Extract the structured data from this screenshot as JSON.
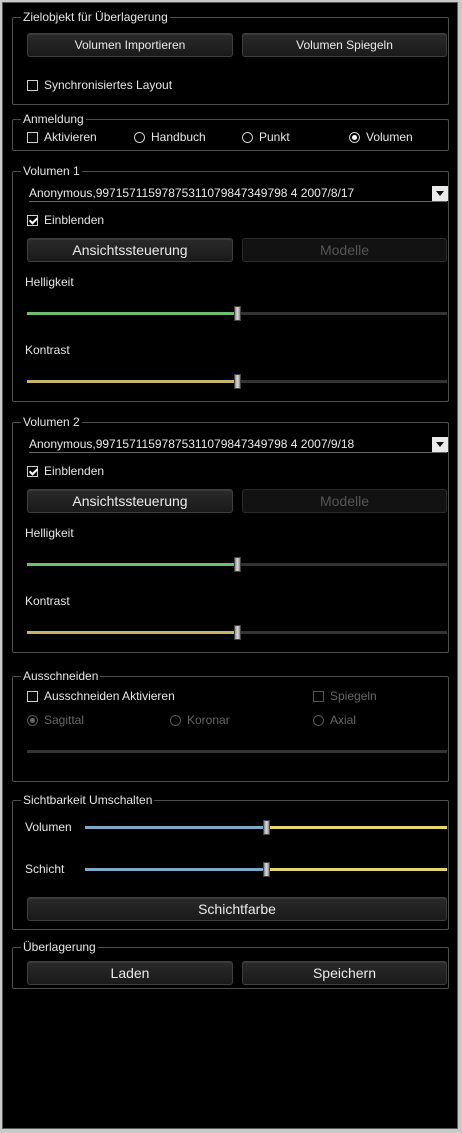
{
  "colors": {
    "brightness_track": "#6fbf6f",
    "contrast_track": "#c8b36a",
    "visibility_left": "#7ea9c9",
    "visibility_right": "#e6d868"
  },
  "target": {
    "title": "Zielobjekt für Überlagerung",
    "import_label": "Volumen Importieren",
    "mirror_label": "Volumen Spiegeln",
    "sync_label": "Synchronisiertes Layout",
    "sync_checked": false
  },
  "registration": {
    "title": "Anmeldung",
    "activate_label": "Aktivieren",
    "activate_checked": false,
    "options": [
      "Handbuch",
      "Punkt",
      "Volumen"
    ],
    "selected": "Volumen"
  },
  "volume1": {
    "title": "Volumen 1",
    "selected_volume": "Anonymous,99715711597875311079847349798 4  2007/8/17",
    "show_label": "Einblenden",
    "show_checked": true,
    "view_control_label": "Ansichtssteuerung",
    "models_label": "Modelle",
    "brightness_label": "Helligkeit",
    "brightness_value": 0.5,
    "contrast_label": "Kontrast",
    "contrast_value": 0.5
  },
  "volume2": {
    "title": "Volumen 2",
    "selected_volume": "Anonymous,99715711597875311079847349798 4  2007/9/18",
    "show_label": "Einblenden",
    "show_checked": true,
    "view_control_label": "Ansichtssteuerung",
    "models_label": "Modelle",
    "brightness_label": "Helligkeit",
    "brightness_value": 0.5,
    "contrast_label": "Kontrast",
    "contrast_value": 0.5
  },
  "cutout": {
    "title": "Ausschneiden",
    "activate_label": "Ausschneiden Aktivieren",
    "activate_checked": false,
    "mirror_label": "Spiegeln",
    "mirror_checked": false,
    "planes": [
      "Sagittal",
      "Koronar",
      "Axial"
    ],
    "selected_plane": "Sagittal"
  },
  "visibility": {
    "title": "Sichtbarkeit Umschalten",
    "volume_label": "Volumen",
    "volume_value": 0.5,
    "slice_label": "Schicht",
    "slice_value": 0.5,
    "slice_color_label": "Schichtfarbe"
  },
  "overlay": {
    "title": "Überlagerung",
    "load_label": "Laden",
    "save_label": "Speichern"
  }
}
